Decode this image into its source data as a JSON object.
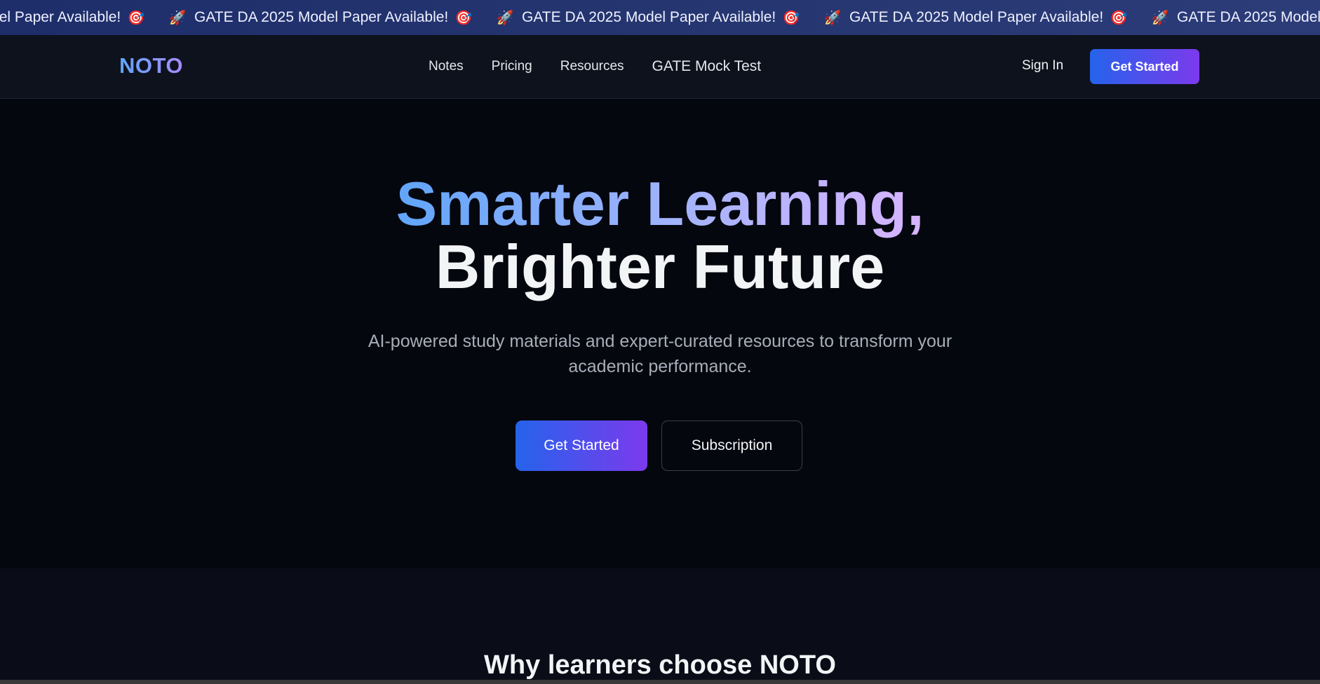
{
  "ticker": {
    "message": "GATE DA 2025 Model Paper Available!",
    "rocket_icon": "🚀",
    "target_icon": "🎯",
    "repeat_count": 5
  },
  "navbar": {
    "logo": "NOTO",
    "links": [
      {
        "label": "Notes"
      },
      {
        "label": "Pricing"
      },
      {
        "label": "Resources"
      },
      {
        "label": "GATE Mock Test"
      }
    ],
    "sign_in": "Sign In",
    "cta": "Get Started"
  },
  "hero": {
    "title_line1": "Smarter Learning,",
    "title_line2": "Brighter Future",
    "subtitle": "AI-powered study materials and expert-curated resources to transform your academic performance.",
    "primary_button": "Get Started",
    "secondary_button": "Subscription"
  },
  "features": {
    "title": "Why learners choose NOTO"
  },
  "colors": {
    "accent_start": "#2563eb",
    "accent_end": "#7c3aed",
    "ticker_bg": "#25356f",
    "nav_bg": "#0e121d",
    "hero_bg": "#05070f"
  }
}
